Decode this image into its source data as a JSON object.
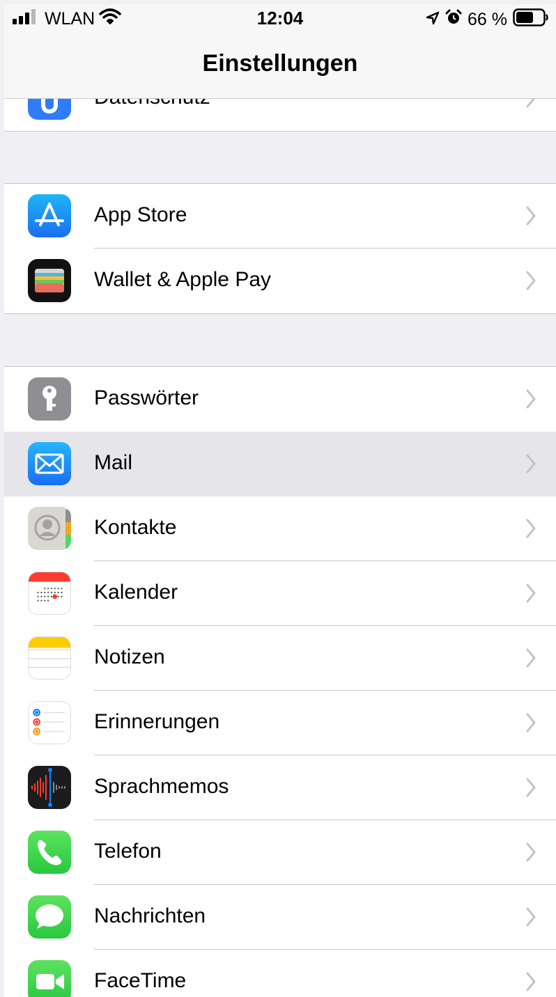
{
  "status_bar": {
    "carrier": "WLAN",
    "time": "12:04",
    "battery_percent": "66 %",
    "battery_level": 0.66,
    "icons": [
      "signal-bars-icon",
      "wifi-icon",
      "location-arrow-icon",
      "alarm-clock-icon",
      "battery-icon"
    ]
  },
  "nav": {
    "title": "Einstellungen"
  },
  "partial_top_row": {
    "label": "Datenschutz",
    "icon": "privacy-hand-icon",
    "color": "#2e7cf6"
  },
  "group1": [
    {
      "label": "App Store",
      "icon": "app-store-icon",
      "color": "#1a8cf6"
    },
    {
      "label": "Wallet & Apple Pay",
      "icon": "wallet-icon",
      "color": "#000000"
    }
  ],
  "group2": [
    {
      "label": "Passwörter",
      "icon": "key-icon",
      "color": "#8e8e93"
    },
    {
      "label": "Mail",
      "icon": "mail-envelope-icon",
      "color": "#1e90ff",
      "selected": true
    },
    {
      "label": "Kontakte",
      "icon": "contacts-icon",
      "color": "#d9d7d2"
    },
    {
      "label": "Kalender",
      "icon": "calendar-icon",
      "color": "#ffffff"
    },
    {
      "label": "Notizen",
      "icon": "notes-icon",
      "color": "#ffffff"
    },
    {
      "label": "Erinnerungen",
      "icon": "reminders-icon",
      "color": "#ffffff"
    },
    {
      "label": "Sprachmemos",
      "icon": "voice-memos-icon",
      "color": "#1c1c1e"
    },
    {
      "label": "Telefon",
      "icon": "phone-icon",
      "color": "#34c759"
    },
    {
      "label": "Nachrichten",
      "icon": "messages-icon",
      "color": "#34c759"
    },
    {
      "label": "FaceTime",
      "icon": "facetime-icon",
      "color": "#34c759"
    }
  ]
}
